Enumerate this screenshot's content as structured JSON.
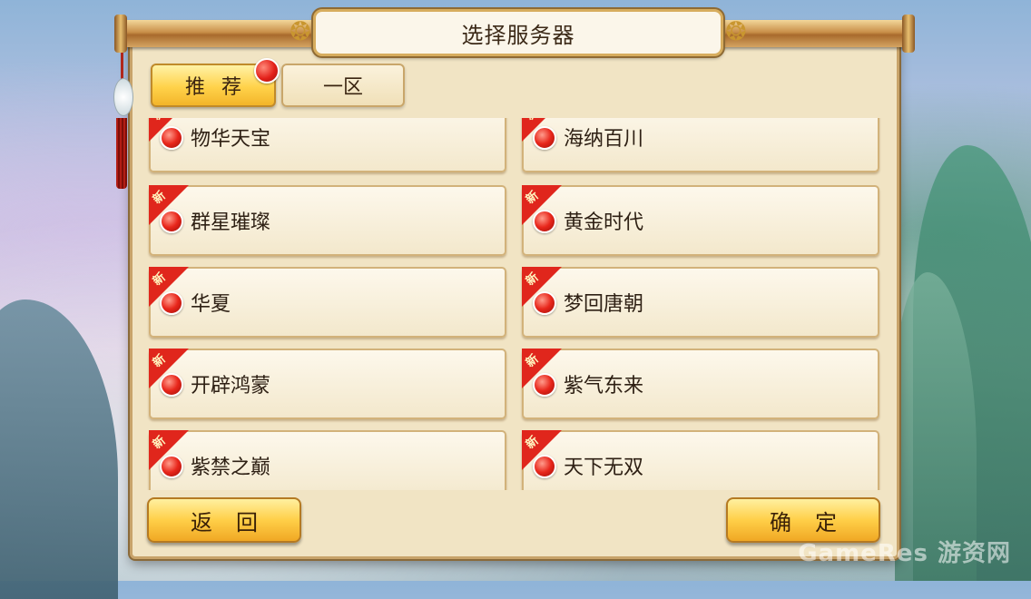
{
  "header": {
    "title": "选择服务器"
  },
  "tabs": [
    {
      "label": "推荐",
      "selected": true,
      "has_badge": true
    },
    {
      "label": "一区",
      "selected": false
    }
  ],
  "servers": [
    {
      "name": "物华天宝",
      "is_new": true
    },
    {
      "name": "海纳百川",
      "is_new": true
    },
    {
      "name": "群星璀璨",
      "is_new": true
    },
    {
      "name": "黄金时代",
      "is_new": true
    },
    {
      "name": "华夏",
      "is_new": true
    },
    {
      "name": "梦回唐朝",
      "is_new": true
    },
    {
      "name": "开辟鸿蒙",
      "is_new": true
    },
    {
      "name": "紫气东来",
      "is_new": true
    },
    {
      "name": "紫禁之巅",
      "is_new": true
    },
    {
      "name": "天下无双",
      "is_new": true
    }
  ],
  "new_tag": "新",
  "footer": {
    "back_label": "返回",
    "confirm_label": "确定"
  },
  "watermark": "GameRes 游资网",
  "colors": {
    "accent_gold": "#ffcf48",
    "status_red": "#e8261b",
    "panel_bg": "#f1e4c4"
  }
}
